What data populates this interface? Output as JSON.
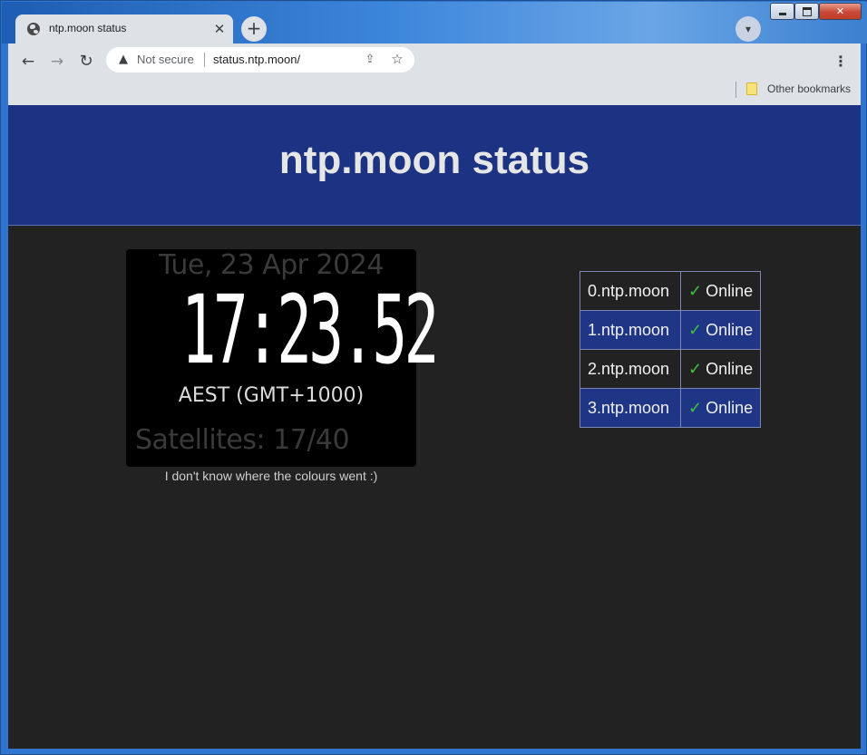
{
  "browser": {
    "tab_title": "ntp.moon status",
    "security_label": "Not secure",
    "url": "status.ntp.moon/",
    "bookmarks": [
      {
        "label": "Other bookmarks"
      }
    ]
  },
  "page": {
    "title": "ntp.moon status",
    "clock": {
      "date": "Tue, 23 Apr 2024",
      "time": "17:23.52",
      "timezone": "AEST (GMT+1000)",
      "satellites": "Satellites: 17/40"
    },
    "caption": "I don't know where the colours went :)",
    "servers": [
      {
        "host": "0.ntp.moon",
        "status": "Online",
        "check": "✓"
      },
      {
        "host": "1.ntp.moon",
        "status": "Online",
        "check": "✓"
      },
      {
        "host": "2.ntp.moon",
        "status": "Online",
        "check": "✓"
      },
      {
        "host": "3.ntp.moon",
        "status": "Online",
        "check": "✓"
      }
    ]
  },
  "icons": {
    "favicon": "globe-icon",
    "close": "close-icon",
    "new_tab": "plus-icon",
    "back": "back-arrow-icon",
    "forward": "forward-arrow-icon",
    "reload": "reload-icon",
    "warning": "warning-icon",
    "share": "share-icon",
    "star": "star-icon",
    "menu": "kebab-menu-icon",
    "folder": "folder-icon"
  },
  "colors": {
    "banner": "#1c3384",
    "page_background": "#222222",
    "check": "#3fc23f"
  }
}
